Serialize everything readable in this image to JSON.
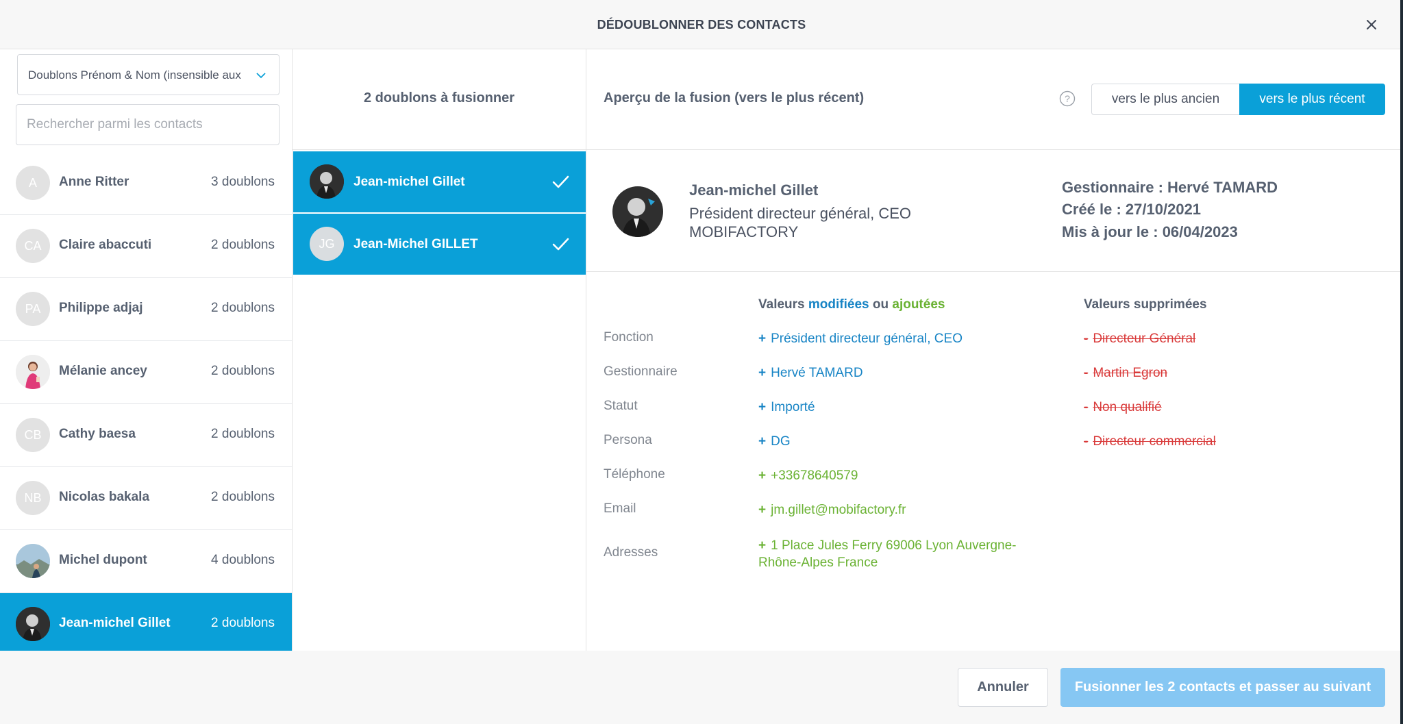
{
  "header": {
    "title": "DÉDOUBLONNER DES CONTACTS",
    "close_icon": "close-icon"
  },
  "sidebar": {
    "filter_select": {
      "selected": "Doublons Prénom & Nom (insensible aux"
    },
    "search": {
      "placeholder": "Rechercher parmi les contacts",
      "value": ""
    },
    "contacts": [
      {
        "name": "Anne Ritter",
        "count": "3 doublons",
        "initials": "A",
        "avatar": "initials",
        "active": false
      },
      {
        "name": "Claire abaccuti",
        "count": "2 doublons",
        "initials": "CA",
        "avatar": "initials",
        "active": false
      },
      {
        "name": "Philippe adjaj",
        "count": "2 doublons",
        "initials": "PA",
        "avatar": "initials",
        "active": false
      },
      {
        "name": "Mélanie ancey",
        "count": "2 doublons",
        "initials": "",
        "avatar": "photo-woman",
        "active": false
      },
      {
        "name": "Cathy baesa",
        "count": "2 doublons",
        "initials": "CB",
        "avatar": "initials",
        "active": false
      },
      {
        "name": "Nicolas bakala",
        "count": "2 doublons",
        "initials": "NB",
        "avatar": "initials",
        "active": false
      },
      {
        "name": "Michel dupont",
        "count": "4 doublons",
        "initials": "",
        "avatar": "photo-landscape",
        "active": false
      },
      {
        "name": "Jean-michel Gillet",
        "count": "2 doublons",
        "initials": "",
        "avatar": "photo-man",
        "active": true
      }
    ]
  },
  "duplicates": {
    "title": "2 doublons à fusionner",
    "items": [
      {
        "name": "Jean-michel Gillet",
        "initials": "",
        "avatar": "photo-man",
        "selected": true,
        "check_icon": "checkmark-icon"
      },
      {
        "name": "Jean-Michel GILLET",
        "initials": "JG",
        "avatar": "initials",
        "selected": true,
        "check_icon": "checkmark-icon"
      }
    ]
  },
  "preview": {
    "title": "Aperçu de la fusion (vers le plus récent)",
    "help_icon": "question-circle-icon",
    "toggle": {
      "older_label": "vers le plus ancien",
      "newer_label": "vers le plus récent",
      "selected": "newer"
    },
    "profile": {
      "name": "Jean-michel Gillet",
      "role": "Président directeur général, CEO",
      "company": "MOBIFACTORY",
      "manager": "Gestionnaire : Hervé TAMARD",
      "created": "Créé le : 27/10/2021",
      "updated": "Mis à jour le : 06/04/2023"
    },
    "changes_header": {
      "prefix": "Valeurs ",
      "modified": "modifiées",
      "or": " ou ",
      "added": "ajoutées"
    },
    "removed_header": "Valeurs supprimées",
    "fields": [
      {
        "label": "Fonction",
        "value": "Président directeur général, CEO",
        "kind": "modified",
        "removed": "Directeur Général"
      },
      {
        "label": "Gestionnaire",
        "value": "Hervé TAMARD",
        "kind": "modified",
        "removed": "Martin Egron"
      },
      {
        "label": "Statut",
        "value": "Importé",
        "kind": "modified",
        "removed": "Non qualifié"
      },
      {
        "label": "Persona",
        "value": "DG",
        "kind": "modified",
        "removed": "Directeur commercial"
      },
      {
        "label": "Téléphone",
        "value": "+33678640579",
        "kind": "added",
        "removed": ""
      },
      {
        "label": "Email",
        "value": "jm.gillet@mobifactory.fr",
        "kind": "added",
        "removed": ""
      },
      {
        "label": "Adresses",
        "value_line1": "1 Place Jules Ferry 69006 Lyon Auvergne-",
        "value_line2": "Rhône-Alpes France",
        "kind": "added",
        "removed": ""
      }
    ],
    "plus_sign": "+",
    "minus_sign": "-"
  },
  "footer": {
    "cancel_label": "Annuler",
    "merge_label": "Fusionner les 2 contacts et passer au suivant"
  },
  "colors": {
    "accent": "#0aa0d8",
    "modified": "#1784c5",
    "added": "#6ab233",
    "removed": "#d93a3a",
    "merge_disabled": "#86c7f3"
  }
}
